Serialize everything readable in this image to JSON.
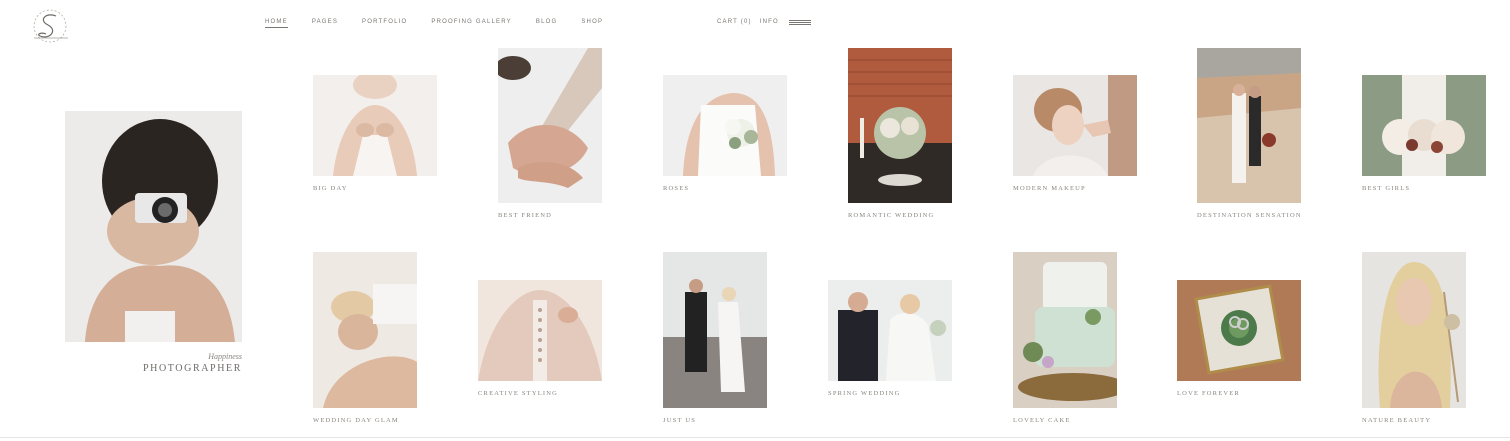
{
  "nav": {
    "items": [
      {
        "label": "HOME",
        "active": true
      },
      {
        "label": "PAGES",
        "active": false
      },
      {
        "label": "PORTFOLIO",
        "active": false
      },
      {
        "label": "PROOFING GALLERY",
        "active": false
      },
      {
        "label": "BLOG",
        "active": false
      },
      {
        "label": "SHOP",
        "active": false
      }
    ],
    "cart_label": "CART (0)",
    "info_label": "INFO"
  },
  "hero": {
    "tagline": "Happiness",
    "title": "PHOTOGRAPHER"
  },
  "gallery": {
    "row1": [
      {
        "caption": "BIG DAY"
      },
      {
        "caption": "BEST FRIEND"
      },
      {
        "caption": "ROSES"
      },
      {
        "caption": "ROMANTIC WEDDING"
      },
      {
        "caption": "MODERN MAKEUP"
      },
      {
        "caption": "DESTINATION SENSATION"
      },
      {
        "caption": "BEST GIRLS"
      }
    ],
    "row2": [
      {
        "caption": "WEDDING DAY GLAM"
      },
      {
        "caption": "CREATIVE STYLING"
      },
      {
        "caption": "JUST US"
      },
      {
        "caption": "SPRING WEDDING"
      },
      {
        "caption": "LOVELY CAKE"
      },
      {
        "caption": "LOVE FOREVER"
      },
      {
        "caption": "NATURE BEAUTY"
      }
    ]
  },
  "colors": {
    "text": "#6e6a66",
    "nav": "#7a7672",
    "background": "#ffffff"
  }
}
